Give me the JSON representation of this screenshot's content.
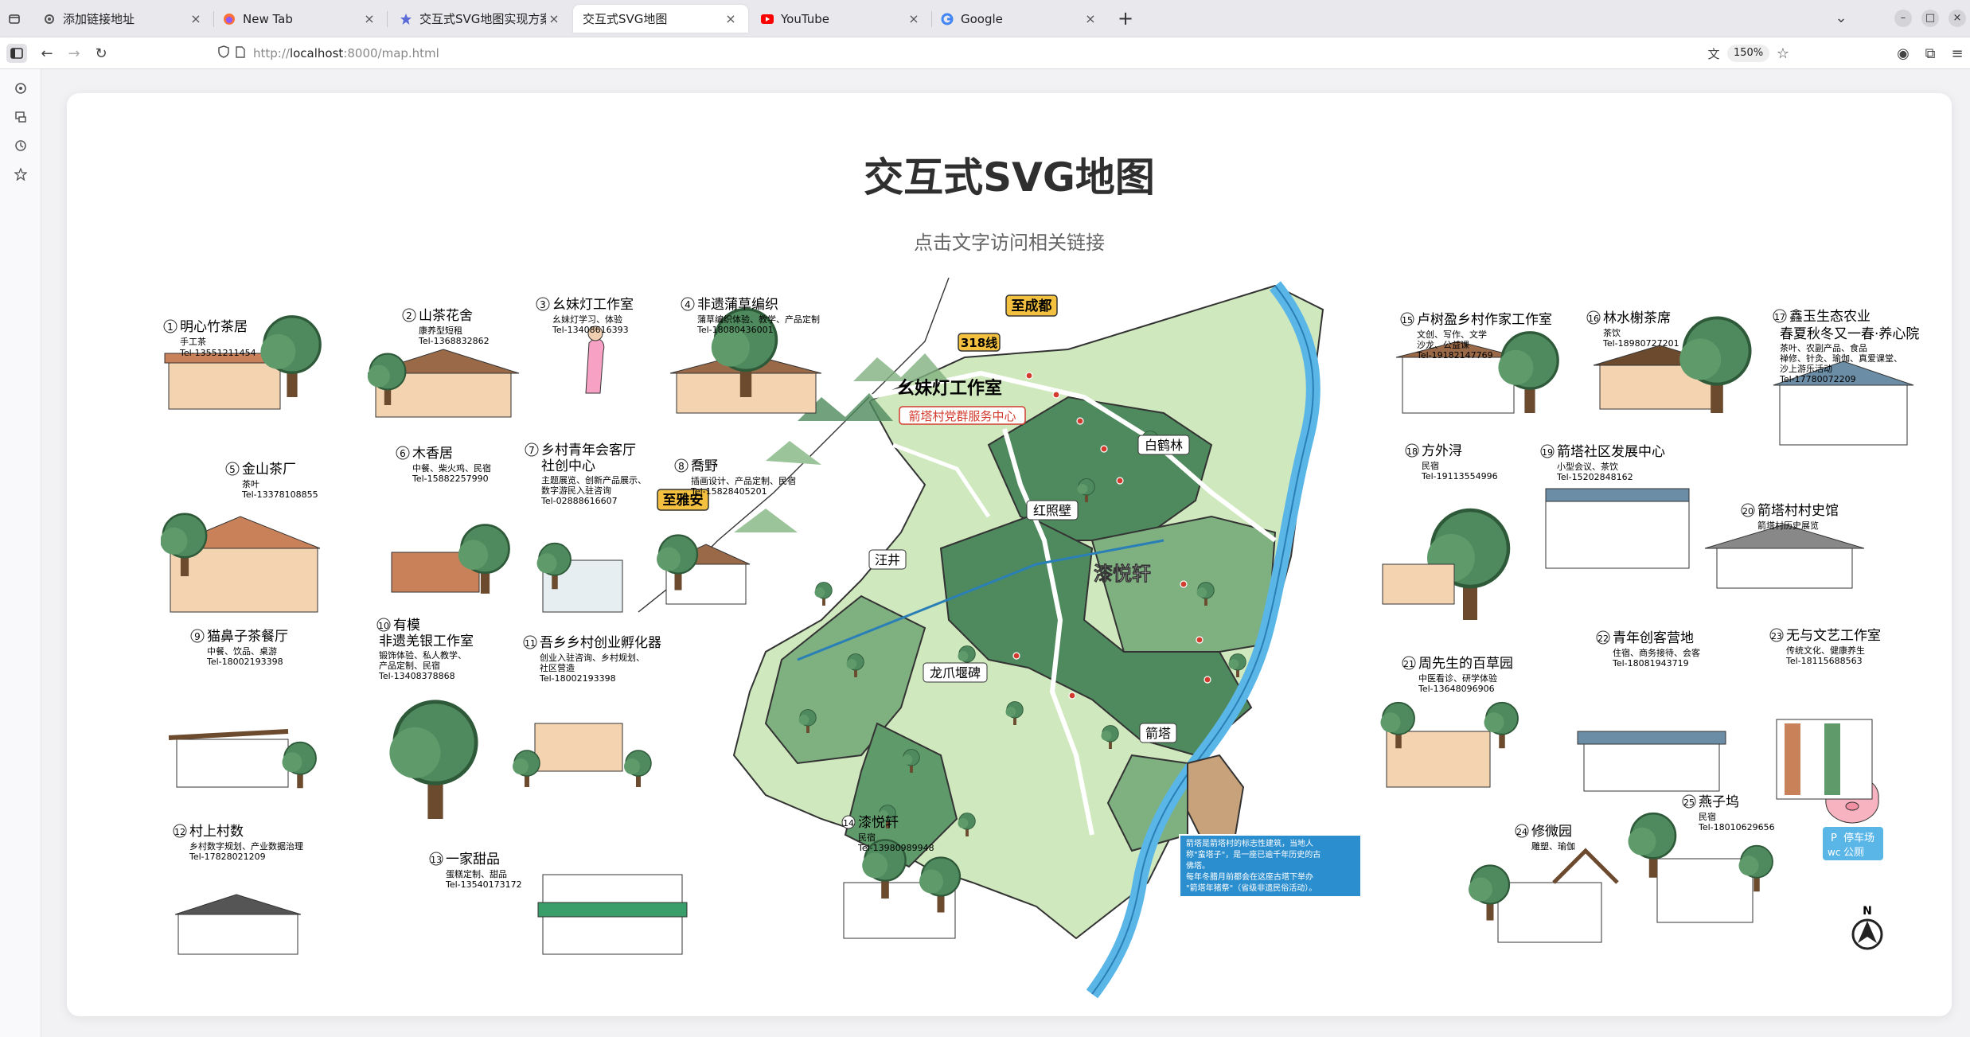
{
  "browser": {
    "tabs": [
      {
        "label": "添加链接地址",
        "favicon": "gear-icon"
      },
      {
        "label": "New Tab",
        "favicon": "firefox-icon"
      },
      {
        "label": "交互式SVG地图实现方案 ·",
        "favicon": "star-icon"
      },
      {
        "label": "交互式SVG地图",
        "favicon": "none",
        "active": true
      },
      {
        "label": "YouTube",
        "favicon": "youtube-icon"
      },
      {
        "label": "Google",
        "favicon": "google-icon"
      }
    ],
    "url_prefix": "http://",
    "url_host": "localhost",
    "url_rest": ":8000/map.html",
    "zoom": "150%"
  },
  "page": {
    "title": "交互式SVG地图",
    "subtitle": "点击文字访问相关链接"
  },
  "map": {
    "places": [
      {
        "num": "1",
        "name": "明心竹茶居",
        "desc": "手工茶",
        "tel": "Tel-13551211454"
      },
      {
        "num": "2",
        "name": "山茶花舍",
        "desc": "康养型短租",
        "tel": "Tel-1368832862"
      },
      {
        "num": "3",
        "name": "幺妹灯工作室",
        "desc": "幺妹灯学习、体验",
        "tel": "Tel-13408616393"
      },
      {
        "num": "4",
        "name": "非遗蒲草编织",
        "desc": "蒲草编织体验、教学、产品定制",
        "tel": "Tel-18080436001"
      },
      {
        "num": "5",
        "name": "金山茶厂",
        "desc": "茶叶",
        "tel": "Tel-13378108855"
      },
      {
        "num": "6",
        "name": "木香居",
        "desc": "中餐、柴火鸡、民宿",
        "tel": "Tel-15882257990"
      },
      {
        "num": "7",
        "name": "乡村青年会客厅",
        "name2": "社创中心",
        "desc": "主题展览、创新产品展示、",
        "desc2": "数字游民入驻咨询",
        "tel": "Tel-02888616607"
      },
      {
        "num": "8",
        "name": "喬野",
        "desc": "插画设计、产品定制、民宿",
        "tel": "Tel-15828405201"
      },
      {
        "num": "9",
        "name": "猫鼻子茶餐厅",
        "desc": "中餐、饮品、桌游",
        "tel": "Tel-18002193398"
      },
      {
        "num": "10",
        "name": "有模",
        "name2": "非遗羌银工作室",
        "desc": "锻饰体验、私人教学、",
        "desc2": "产品定制、民宿",
        "tel": "Tel-13408378868"
      },
      {
        "num": "11",
        "name": "吾乡乡村创业孵化器",
        "desc": "创业入驻咨询、乡村规划、",
        "desc2": "社区营造",
        "tel": "Tel-18002193398"
      },
      {
        "num": "12",
        "name": "村上村数",
        "desc": "乡村数字规划、产业数据治理",
        "tel": "Tel-17828021209"
      },
      {
        "num": "13",
        "name": "一家甜品",
        "desc": "蛋糕定制、甜品",
        "tel": "Tel-13540173172"
      },
      {
        "num": "14",
        "name": "漆悦轩",
        "desc": "民宿",
        "tel": "Tel-13980989948"
      },
      {
        "num": "15",
        "name": "卢树盈乡村作家工作室",
        "desc": "文创、写作、文学",
        "desc2": "沙龙、公益课",
        "tel": "Tel-19182147769"
      },
      {
        "num": "16",
        "name": "林水榭茶席",
        "desc": "茶饮",
        "tel": "Tel-18980727201"
      },
      {
        "num": "17",
        "name": "鑫玉生态农业",
        "name2": "春夏秋冬又一春·养心院",
        "desc": "茶叶、农副产品、食品",
        "desc2": "禅修、针灸、瑜伽、真爱课堂、",
        "desc3": "沙上游乐活动",
        "tel": "Tel-17780072209"
      },
      {
        "num": "18",
        "name": "方外浔",
        "desc": "民宿",
        "tel": "Tel-19113554996"
      },
      {
        "num": "19",
        "name": "箭塔社区发展中心",
        "desc": "小型会议、茶饮",
        "tel": "Tel-15202848162"
      },
      {
        "num": "20",
        "name": "箭塔村村史馆",
        "desc": "箭塔村历史展览",
        "tel": ""
      },
      {
        "num": "21",
        "name": "周先生的百草园",
        "desc": "中医看诊、研学体验",
        "tel": "Tel-13648096906"
      },
      {
        "num": "22",
        "name": "青年创客营地",
        "desc": "住宿、商务接待、会客",
        "tel": "Tel-18081943719"
      },
      {
        "num": "23",
        "name": "无与文艺工作室",
        "desc": "传统文化、健康养生",
        "tel": "Tel-18115688563"
      },
      {
        "num": "24",
        "name": "修微园",
        "desc": "雕塑、瑜伽",
        "tel": ""
      },
      {
        "num": "25",
        "name": "燕子坞",
        "desc": "民宿",
        "tel": "Tel-18010629656"
      }
    ],
    "landmarks": {
      "to_chengdu": "至成都",
      "route_318": "318线",
      "to_yaan": "至雅安",
      "yaomei": "幺妹灯工作室",
      "party_center": "箭塔村党群服务中心",
      "baihelin": "白鹤林",
      "hongzhaobi": "红照壁",
      "qiyuexuan": "漆悦轩",
      "wangjing": "汪井",
      "longzhua": "龙爪堰碑",
      "jianta": "箭塔"
    },
    "note_lines": [
      "箭塔是箭塔村的标志性建筑，当地人",
      "称\"蛮塔子\"，是一座已逾千年历史的古",
      "佛塔。",
      "每年冬腊月前都会在这座古塔下举办",
      "\"箭塔年猪祭\"（省级非遗民俗活动）。"
    ],
    "legend": {
      "parking": "停车场",
      "toilet": "公厕",
      "p": "P",
      "wc": "wc"
    },
    "north": "N",
    "colors": {
      "dark_green": "#4f8a5e",
      "light_green": "#cfe8bd",
      "mid_green": "#7fb080",
      "river": "#5bb6e8",
      "red": "#d23b2e",
      "accent_yellow": "#f4c040"
    }
  }
}
